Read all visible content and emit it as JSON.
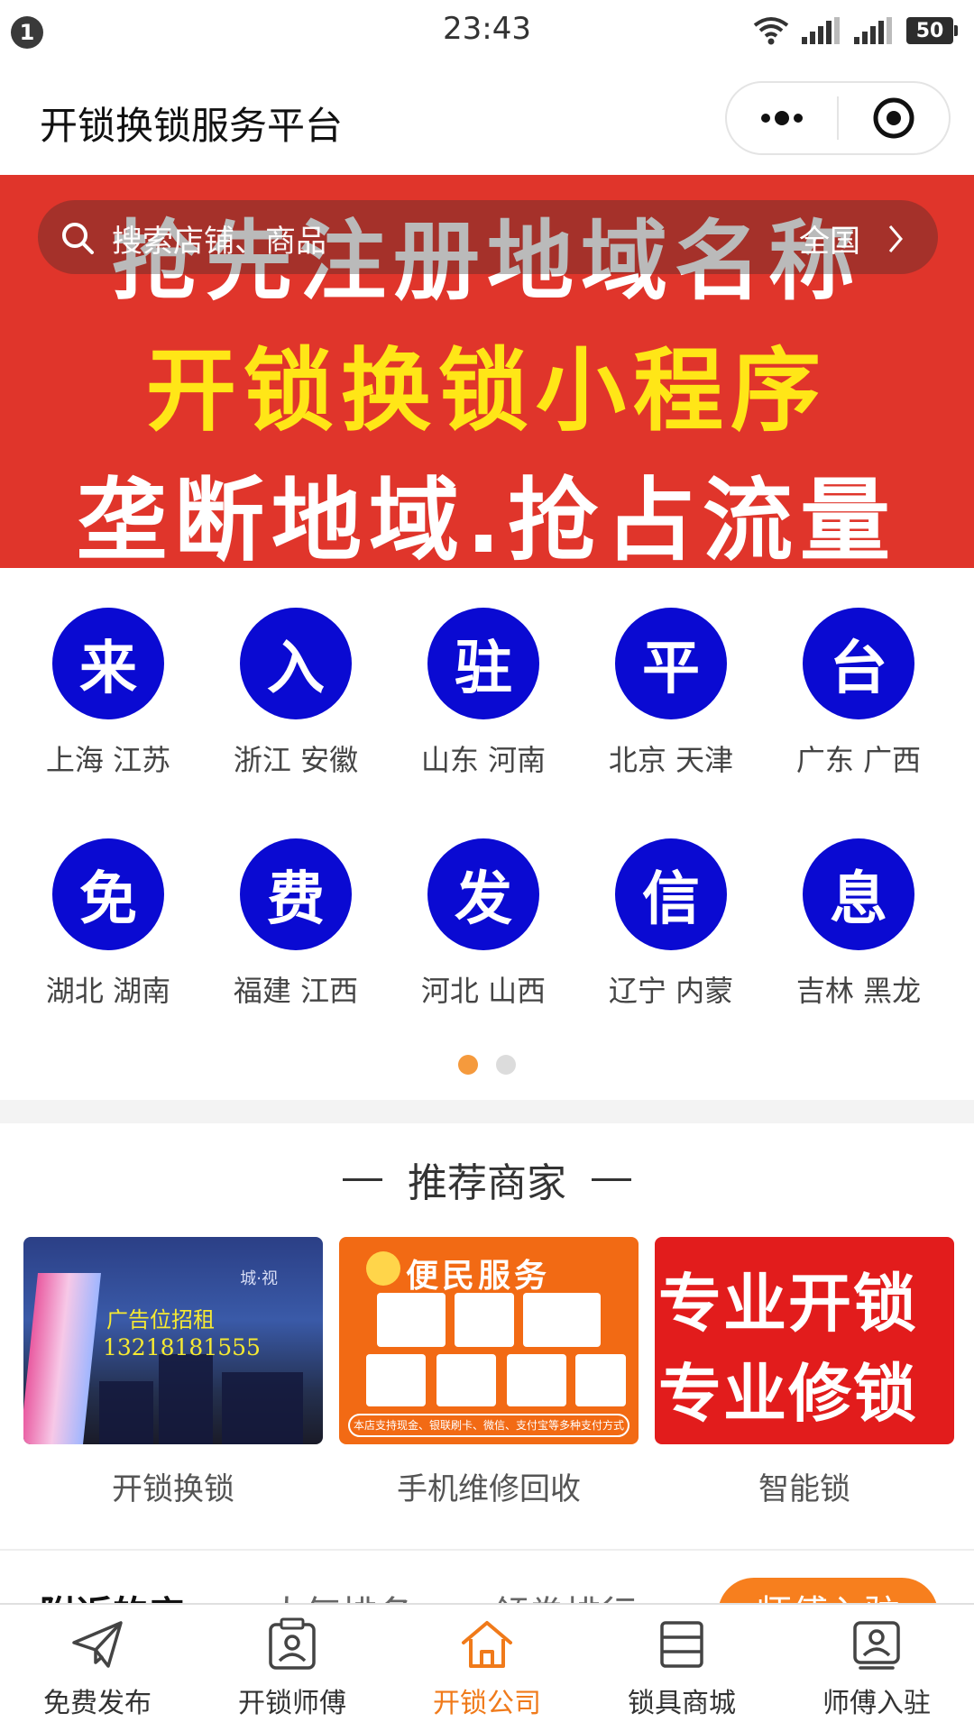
{
  "status_bar": {
    "notification_count": "1",
    "time": "23:43",
    "battery": "50"
  },
  "title_bar": {
    "title": "开锁换锁服务平台"
  },
  "banner": {
    "line1": "抢先注册地域名称",
    "line2": "开锁换锁小程序",
    "line3": "垄断地域.抢占流量",
    "search_placeholder": "搜索店铺、商品",
    "region": "全国"
  },
  "grid": {
    "items": [
      {
        "glyph": "来",
        "label": "上海 江苏"
      },
      {
        "glyph": "入",
        "label": "浙江 安徽"
      },
      {
        "glyph": "驻",
        "label": "山东 河南"
      },
      {
        "glyph": "平",
        "label": "北京 天津"
      },
      {
        "glyph": "台",
        "label": "广东 广西"
      },
      {
        "glyph": "免",
        "label": "湖北 湖南"
      },
      {
        "glyph": "费",
        "label": "福建 江西"
      },
      {
        "glyph": "发",
        "label": "河北 山西"
      },
      {
        "glyph": "信",
        "label": "辽宁 内蒙"
      },
      {
        "glyph": "息",
        "label": "吉林 黑龙"
      }
    ],
    "page_count": 2,
    "active_page": 1
  },
  "recommended": {
    "title": "推荐商家",
    "merchants": [
      {
        "label": "开锁换锁",
        "ad_line1": "广告位招租",
        "ad_line2": "13218181555",
        "watermark": "城·视"
      },
      {
        "label": "手机维修回收",
        "headline": "便民服务",
        "footer": "本店支持现金、银联刷卡、微信、支付宝等多种支付方式"
      },
      {
        "label": "智能锁",
        "line1": "专业开锁",
        "line2": "专业修锁"
      }
    ]
  },
  "tabs": {
    "items": [
      "附近的店",
      "人气排名",
      "领券排行"
    ],
    "cta": "师傅入驻"
  },
  "bottom_nav": {
    "items": [
      {
        "label": "免费发布",
        "icon": "paper-plane-icon"
      },
      {
        "label": "开锁师傅",
        "icon": "id-card-icon"
      },
      {
        "label": "开锁公司",
        "icon": "home-icon"
      },
      {
        "label": "锁具商城",
        "icon": "store-icon"
      },
      {
        "label": "师傅入驻",
        "icon": "profile-card-icon"
      }
    ],
    "active_index": 2
  },
  "colors": {
    "accent": "#f07a1a",
    "banner_red": "#e0352b",
    "circle_blue": "#0a0ad2"
  }
}
